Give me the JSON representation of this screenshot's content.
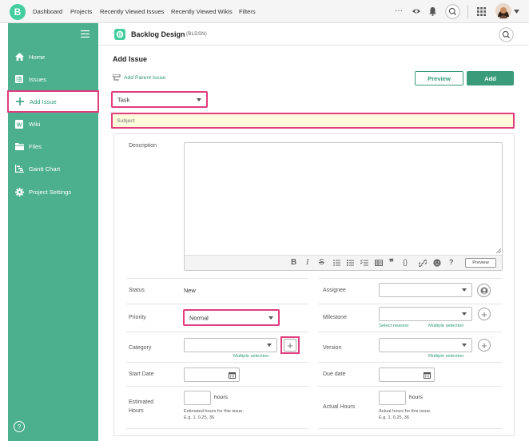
{
  "topbar": {
    "nav": [
      "Dashboard",
      "Projects",
      "Recently Viewed Issues",
      "Recently Viewed Wikis",
      "Filters"
    ],
    "more": "···"
  },
  "sidebar": {
    "items": [
      {
        "label": "Home",
        "icon": "home-icon"
      },
      {
        "label": "Issues",
        "icon": "list-icon"
      },
      {
        "label": "Add Issue",
        "icon": "plus-icon"
      },
      {
        "label": "Wiki",
        "icon": "wiki-icon"
      },
      {
        "label": "Files",
        "icon": "files-icon"
      },
      {
        "label": "Gantt Chart",
        "icon": "gantt-icon"
      },
      {
        "label": "Project Settings",
        "icon": "gear-icon"
      }
    ],
    "help": "?",
    "menu_icon": "hamburger-icon"
  },
  "project": {
    "name": "Backlog Design",
    "key": "(BLDSN)"
  },
  "form": {
    "title": "Add Issue",
    "add_parent": "Add Parent Issue",
    "preview_label": "Preview",
    "add_label": "Add",
    "issue_type": "Task",
    "subject_placeholder": "Subject",
    "description_label": "Description",
    "editor_preview": "Preview",
    "fields": {
      "status_label": "Status",
      "status_value": "New",
      "assignee_label": "Assignee",
      "priority_label": "Priority",
      "priority_value": "Normal",
      "milestone_label": "Milestone",
      "select_nearest": "Select nearest",
      "multiple_selection": "Multiple selection",
      "category_label": "Category",
      "version_label": "Version",
      "start_date_label": "Start Date",
      "due_date_label": "Due date",
      "estimated_label_1": "Estimated",
      "estimated_label_2": "Hours",
      "actual_label": "Actual Hours",
      "hours_unit": "hours",
      "estimated_hint_1": "Estimated hours for this issue.",
      "actual_hint_1": "Actual hours for this issue.",
      "hint_2": "E.g. 1, 0.25, 36"
    }
  },
  "colors": {
    "brand": "#4caf8e",
    "highlight": "#e03c7e",
    "add_button": "#3a9b7a"
  }
}
